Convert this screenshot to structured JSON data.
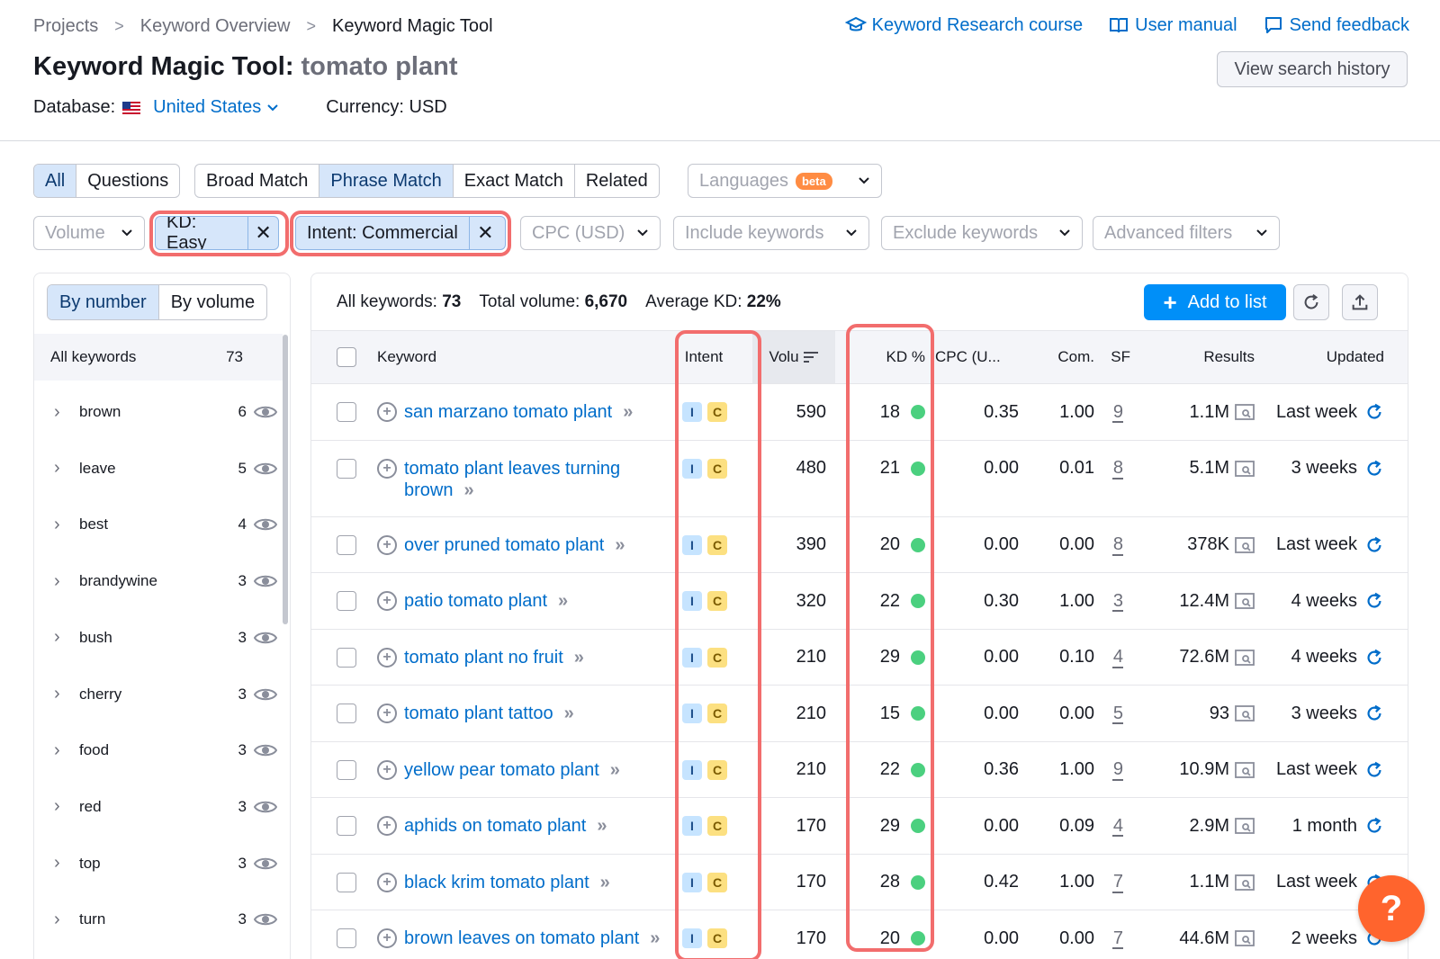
{
  "breadcrumb": [
    "Projects",
    "Keyword Overview",
    "Keyword Magic Tool"
  ],
  "top_links": {
    "course": "Keyword Research course",
    "manual": "User manual",
    "feedback": "Send feedback"
  },
  "title": {
    "tool": "Keyword Magic Tool:",
    "query": "tomato plant"
  },
  "view_history": "View search history",
  "database": {
    "label": "Database:",
    "value": "United States",
    "currency": "Currency: USD"
  },
  "tabs_type": [
    "All",
    "Questions"
  ],
  "tabs_match": [
    "Broad Match",
    "Phrase Match",
    "Exact Match",
    "Related"
  ],
  "languages": {
    "label": "Languages",
    "badge": "beta"
  },
  "filters": {
    "volume": "Volume",
    "kd_chip": "KD: Easy",
    "intent_chip": "Intent: Commercial",
    "cpc": "CPC (USD)",
    "include": "Include keywords",
    "exclude": "Exclude keywords",
    "advanced": "Advanced filters"
  },
  "left_panel": {
    "toggle": [
      "By number",
      "By volume"
    ],
    "all_label": "All keywords",
    "all_count": "73",
    "groups": [
      {
        "name": "brown",
        "count": "6"
      },
      {
        "name": "leave",
        "count": "5"
      },
      {
        "name": "best",
        "count": "4"
      },
      {
        "name": "brandywine",
        "count": "3"
      },
      {
        "name": "bush",
        "count": "3"
      },
      {
        "name": "cherry",
        "count": "3"
      },
      {
        "name": "food",
        "count": "3"
      },
      {
        "name": "red",
        "count": "3"
      },
      {
        "name": "top",
        "count": "3"
      },
      {
        "name": "turn",
        "count": "3"
      }
    ]
  },
  "summary": {
    "all_label": "All keywords:",
    "all_value": "73",
    "vol_label": "Total volume:",
    "vol_value": "6,670",
    "kd_label": "Average KD:",
    "kd_value": "22%"
  },
  "add_to_list": "Add to list",
  "columns": {
    "keyword": "Keyword",
    "intent": "Intent",
    "volume": "Volu",
    "kd": "KD %",
    "cpc": "CPC (U...",
    "com": "Com.",
    "sf": "SF",
    "results": "Results",
    "updated": "Updated"
  },
  "rows": [
    {
      "kw1": "san marzano tomato plant",
      "kw2": "",
      "i": "I",
      "c": "C",
      "vol": "590",
      "kd": "18",
      "cpc": "0.35",
      "com": "1.00",
      "sf": "9",
      "results": "1.1M",
      "updated": "Last week"
    },
    {
      "kw1": "tomato plant leaves turning",
      "kw2": "brown",
      "i": "I",
      "c": "C",
      "vol": "480",
      "kd": "21",
      "cpc": "0.00",
      "com": "0.01",
      "sf": "8",
      "results": "5.1M",
      "updated": "3 weeks"
    },
    {
      "kw1": "over pruned tomato plant",
      "kw2": "",
      "i": "I",
      "c": "C",
      "vol": "390",
      "kd": "20",
      "cpc": "0.00",
      "com": "0.00",
      "sf": "8",
      "results": "378K",
      "updated": "Last week"
    },
    {
      "kw1": "patio tomato plant",
      "kw2": "",
      "i": "I",
      "c": "C",
      "vol": "320",
      "kd": "22",
      "cpc": "0.30",
      "com": "1.00",
      "sf": "3",
      "results": "12.4M",
      "updated": "4 weeks"
    },
    {
      "kw1": "tomato plant no fruit",
      "kw2": "",
      "i": "I",
      "c": "C",
      "vol": "210",
      "kd": "29",
      "cpc": "0.00",
      "com": "0.10",
      "sf": "4",
      "results": "72.6M",
      "updated": "4 weeks"
    },
    {
      "kw1": "tomato plant tattoo",
      "kw2": "",
      "i": "I",
      "c": "C",
      "vol": "210",
      "kd": "15",
      "cpc": "0.00",
      "com": "0.00",
      "sf": "5",
      "results": "93",
      "updated": "3 weeks"
    },
    {
      "kw1": "yellow pear tomato plant",
      "kw2": "",
      "i": "I",
      "c": "C",
      "vol": "210",
      "kd": "22",
      "cpc": "0.36",
      "com": "1.00",
      "sf": "9",
      "results": "10.9M",
      "updated": "Last week"
    },
    {
      "kw1": "aphids on tomato plant",
      "kw2": "",
      "i": "I",
      "c": "C",
      "vol": "170",
      "kd": "29",
      "cpc": "0.00",
      "com": "0.09",
      "sf": "4",
      "results": "2.9M",
      "updated": "1 month"
    },
    {
      "kw1": "black krim tomato plant",
      "kw2": "",
      "i": "I",
      "c": "C",
      "vol": "170",
      "kd": "28",
      "cpc": "0.42",
      "com": "1.00",
      "sf": "7",
      "results": "1.1M",
      "updated": "Last week"
    },
    {
      "kw1": "brown leaves on tomato plant",
      "kw2": "",
      "i": "I",
      "c": "C",
      "vol": "170",
      "kd": "20",
      "cpc": "0.00",
      "com": "0.00",
      "sf": "7",
      "results": "44.6M",
      "updated": "2 weeks"
    }
  ],
  "help": "?"
}
